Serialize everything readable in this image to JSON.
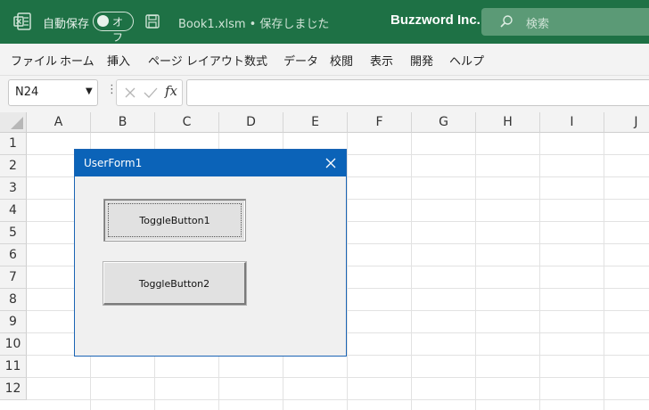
{
  "titlebar": {
    "autosave_label": "自動保存",
    "autosave_state": "オフ",
    "document_title": "Book1.xlsm • 保存しました",
    "brand": "Buzzword Inc.",
    "search_placeholder": "検索",
    "accent_color": "#1e7145"
  },
  "menu": {
    "items": [
      "ファイル",
      "ホーム",
      "挿入",
      "ページ レイアウト",
      "数式",
      "データ",
      "校閲",
      "表示",
      "開発",
      "ヘルプ"
    ]
  },
  "formula_bar": {
    "name_box": "N24",
    "fx_label": "fx",
    "formula_value": ""
  },
  "sheet": {
    "columns": [
      "A",
      "B",
      "C",
      "D",
      "E",
      "F",
      "G",
      "H",
      "I",
      "J"
    ],
    "rows": [
      "1",
      "2",
      "3",
      "4",
      "5",
      "6",
      "7",
      "8",
      "9",
      "10",
      "11",
      "12"
    ]
  },
  "userform": {
    "title": "UserForm1",
    "title_color": "#0b63b8",
    "toggle_buttons": [
      {
        "label": "ToggleButton1",
        "state": "pressed"
      },
      {
        "label": "ToggleButton2",
        "state": "released"
      }
    ]
  }
}
